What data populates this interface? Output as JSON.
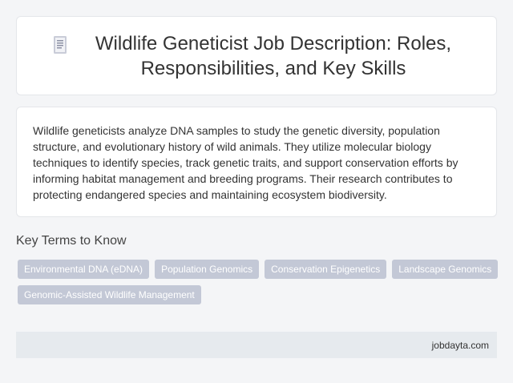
{
  "header": {
    "title": "Wildlife Geneticist Job Description: Roles, Responsibilities, and Key Skills",
    "icon": "document-icon"
  },
  "summary": {
    "text": "Wildlife geneticists analyze DNA samples to study the genetic diversity, population structure, and evolutionary history of wild animals. They utilize molecular biology techniques to identify species, track genetic traits, and support conservation efforts by informing habitat management and breeding programs. Their research contributes to protecting endangered species and maintaining ecosystem biodiversity."
  },
  "key_terms": {
    "heading": "Key Terms to Know",
    "tags": [
      "Environmental DNA (eDNA)",
      "Population Genomics",
      "Conservation Epigenetics",
      "Landscape Genomics",
      "Genomic-Assisted Wildlife Management"
    ]
  },
  "footer": {
    "source": "jobdayta.com"
  },
  "colors": {
    "background": "#f4f5f7",
    "card": "#ffffff",
    "tag": "#c3c8d6",
    "footer": "#e6eaee"
  }
}
